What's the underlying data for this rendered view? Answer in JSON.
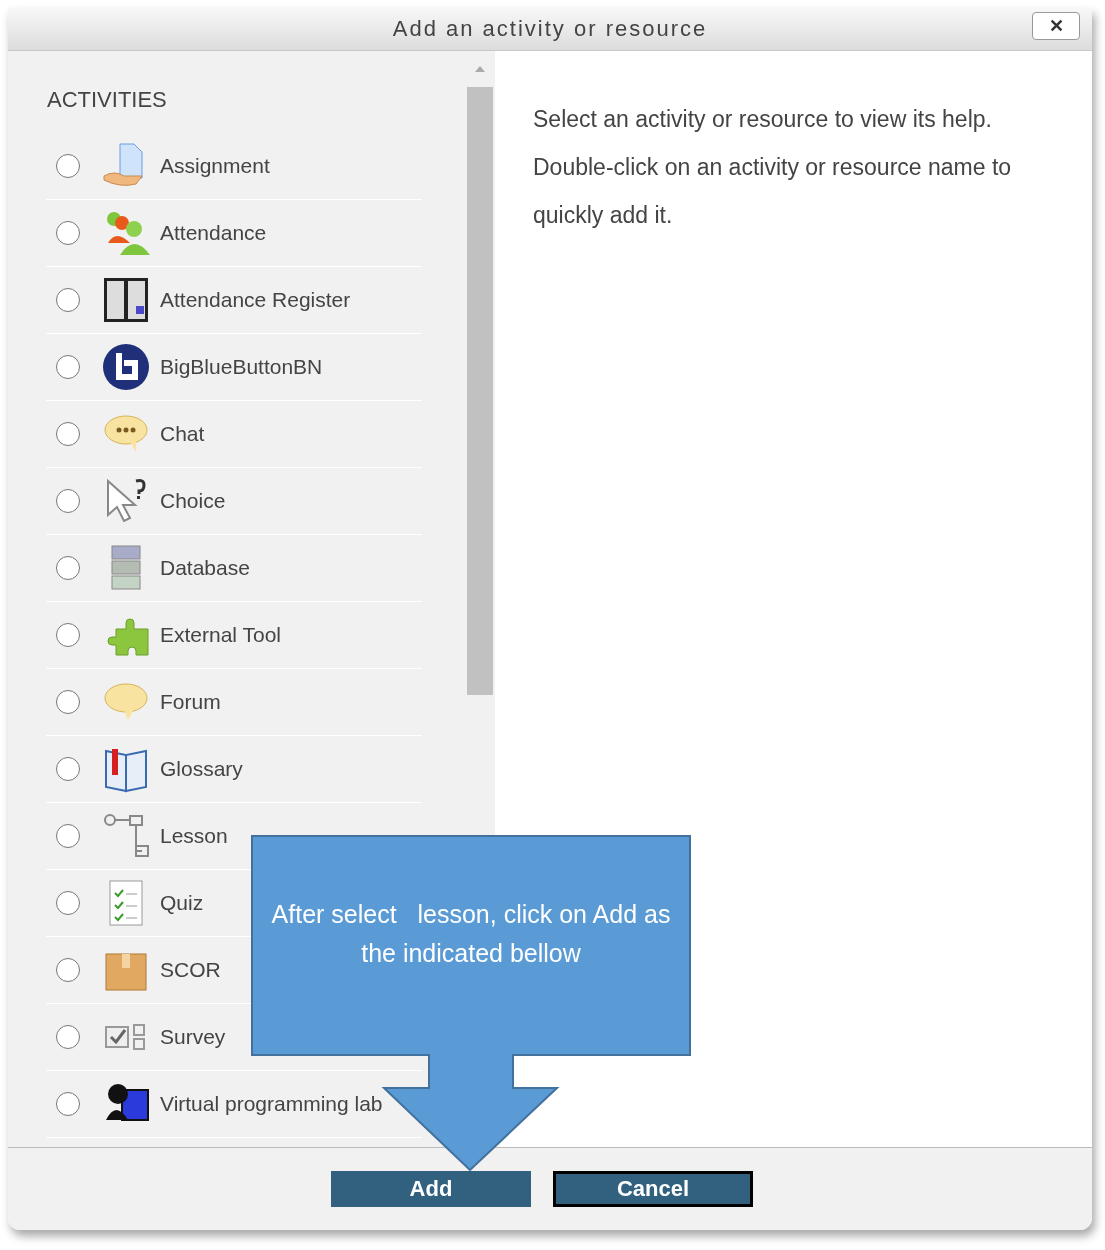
{
  "dialog": {
    "title": "Add an activity or resource",
    "close": "✕"
  },
  "section_heading": "ACTIVITIES",
  "activities": [
    {
      "label": "Assignment",
      "selected": false
    },
    {
      "label": "Attendance",
      "selected": false
    },
    {
      "label": "Attendance Register",
      "selected": false
    },
    {
      "label": "BigBlueButtonBN",
      "selected": false
    },
    {
      "label": "Chat",
      "selected": false
    },
    {
      "label": "Choice",
      "selected": false
    },
    {
      "label": "Database",
      "selected": false
    },
    {
      "label": "External Tool",
      "selected": false
    },
    {
      "label": "Forum",
      "selected": false
    },
    {
      "label": "Glossary",
      "selected": false
    },
    {
      "label": "Lesson",
      "selected": false
    },
    {
      "label": "Quiz",
      "selected": false
    },
    {
      "label": "SCOR",
      "selected": false
    },
    {
      "label": "Survey",
      "selected": false
    },
    {
      "label": "Virtual programming lab",
      "selected": false
    }
  ],
  "help": [
    "Select an activity or resource to view its help.",
    "Double-click on an activity or resource name to quickly add it."
  ],
  "buttons": [
    {
      "label": "Add",
      "kind": "primary"
    },
    {
      "label": "Cancel",
      "kind": "focused"
    }
  ],
  "callout": {
    "text": "After select   lesson, click on Add as the indicated bellow"
  }
}
